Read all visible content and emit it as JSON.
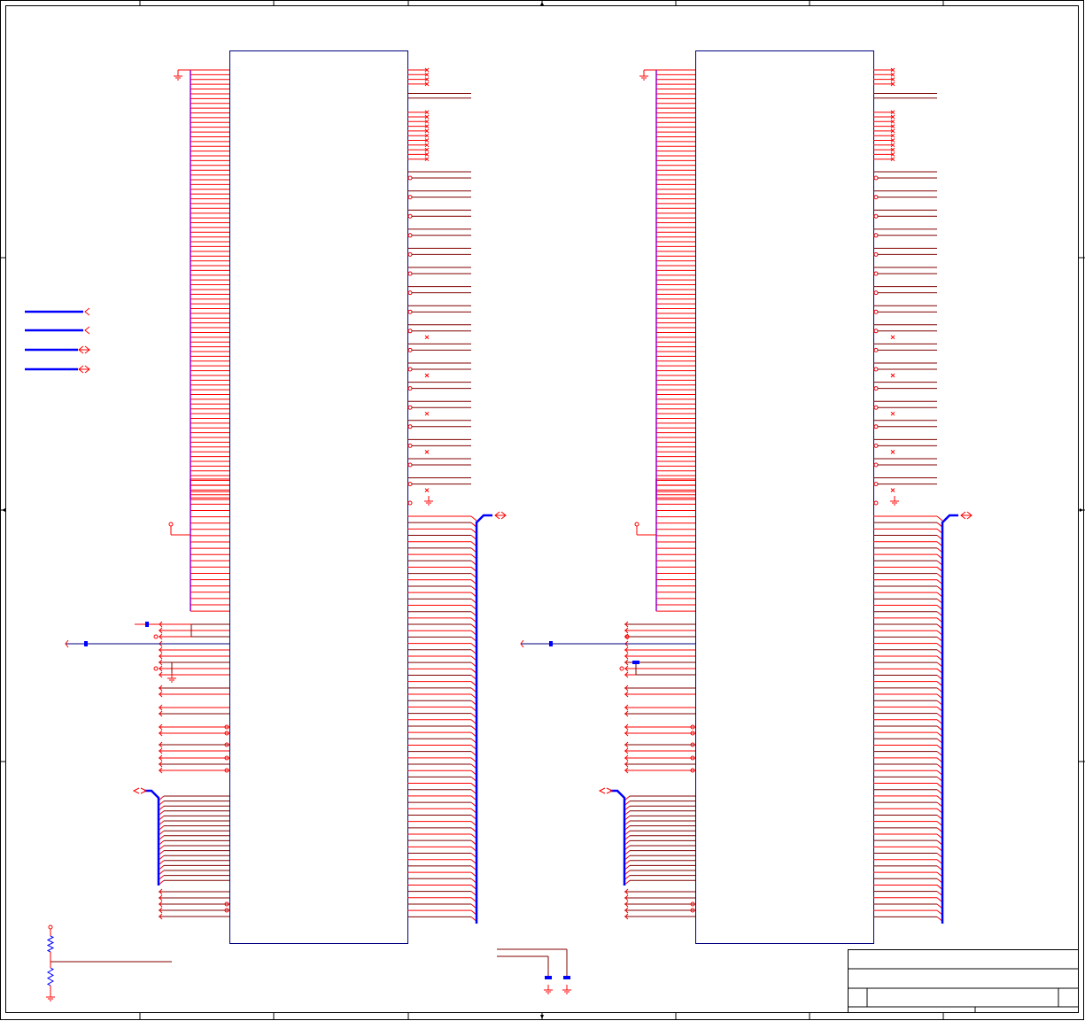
{
  "sheet": {
    "background": "#ffffff",
    "border_color": "#000000",
    "zone_columns": 8,
    "zone_rows": 4
  },
  "title_block": {
    "title": "",
    "document_number": "",
    "revision": "",
    "sheet": ""
  },
  "colors": {
    "wire": "#800000",
    "pin": "#ff0000",
    "component_outline": "#000080",
    "bus": "#0000ff",
    "net_purple": "#9900cc",
    "power": "#cc0000"
  },
  "components": [
    {
      "name": "chip-u1",
      "reference": "",
      "value": ""
    },
    {
      "name": "chip-u2",
      "reference": "",
      "value": ""
    }
  ],
  "pins": {
    "left_top_pins": 91,
    "left_lower_pins": 22,
    "right_data_pins": 64
  },
  "off_sheet_ports": [
    {
      "name": "port-1",
      "direction": "input"
    },
    {
      "name": "port-2",
      "direction": "input"
    },
    {
      "name": "port-3",
      "direction": "bidirectional"
    },
    {
      "name": "port-4",
      "direction": "bidirectional"
    }
  ]
}
